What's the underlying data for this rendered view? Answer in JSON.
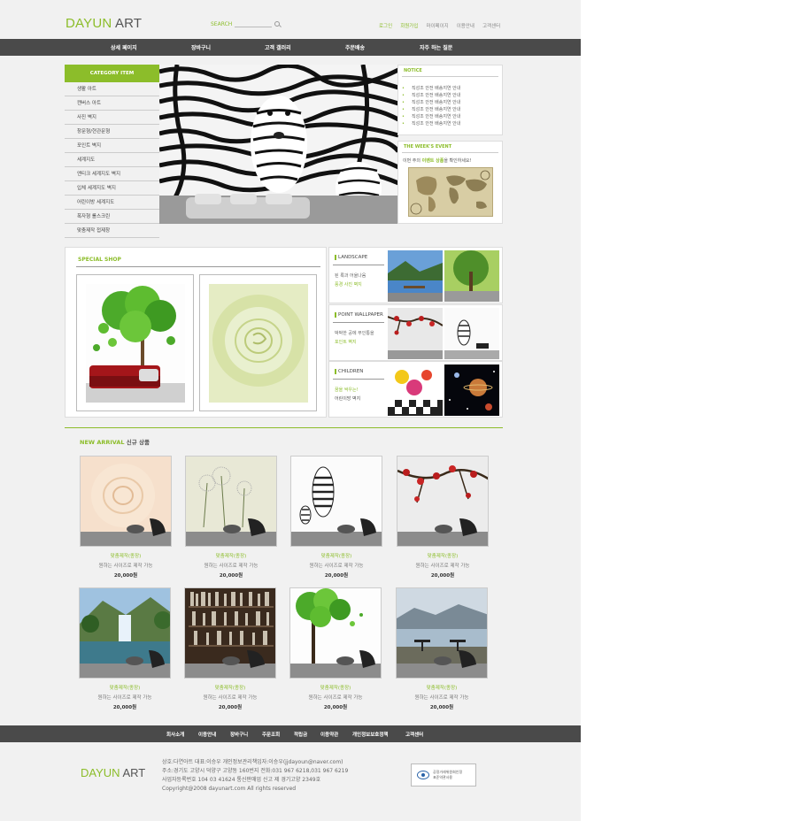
{
  "header": {
    "logo_green": "DAYUN",
    "logo_dark": " ART",
    "search_label": "SEARCH",
    "links": [
      "로그인",
      "회원가입",
      "마이페이지",
      "이용안내",
      "고객센터"
    ]
  },
  "gnb": [
    "상세 페이지",
    "장바구니",
    "고객 갤러리",
    "주문배송",
    "자주 하는 질문"
  ],
  "category": {
    "title": "CATEGORY ITEM",
    "items": [
      "생활 아트",
      "캔버스 아트",
      "사진 벽지",
      "창문형/현관문형",
      "포인트 벽지",
      "세계지도",
      "앤티크 세계지도 벽지",
      "입체 세계지도 벽지",
      "어린이방 세계지도",
      "폭자형 롤스크린",
      "맞춤제작 접제창"
    ]
  },
  "notice": {
    "title": "NOTICE",
    "items": [
      "직성조 안전 배송지연 안내",
      "직성조 안전 배송지연 안내",
      "직성조 안전 배송지연 안내",
      "직성조 안전 배송지연 안내",
      "직성조 안전 배송지연 안내",
      "직성조 안전 배송지연 안내"
    ]
  },
  "event": {
    "title": "THE WEEK'S EVENT",
    "text_pre": "이번 주의 ",
    "text_hl": "이벤트 상품",
    "text_post": "을 확인하세요!"
  },
  "special": {
    "title": "SPECIAL SHOP"
  },
  "themes": [
    {
      "name": "LANDSCAPE",
      "sub1": "된 록과 어울나움",
      "sub2": "풍경 사진 벽지"
    },
    {
      "name": "POINT WALLPAPER",
      "sub1": "박박한 공에 부인통을",
      "sub2": "포인트 벽지"
    },
    {
      "name": "CHILDREN",
      "sub1": "꿈을 싹우는!",
      "sub2": "어린이방 벽지"
    }
  ],
  "new_arrival": {
    "title_en": "NEW ARRIVAL",
    "title_ko": " 신규 상품"
  },
  "products": [
    {
      "name": "맞춤제작(종장)",
      "desc": "원하는 사이즈로 제작 가능",
      "price": "20,000원"
    },
    {
      "name": "맞춤제작(종장)",
      "desc": "원하는 사이즈로 제작 가능",
      "price": "20,000원"
    },
    {
      "name": "맞춤제작(종장)",
      "desc": "원하는 사이즈로 제작 가능",
      "price": "20,000원"
    },
    {
      "name": "맞춤제작(종장)",
      "desc": "원하는 사이즈로 제작 가능",
      "price": "20,000원"
    },
    {
      "name": "맞춤제작(종장)",
      "desc": "원하는 사이즈로 제작 가능",
      "price": "20,000원"
    },
    {
      "name": "맞춤제작(종장)",
      "desc": "원하는 사이즈로 제작 가능",
      "price": "20,000원"
    },
    {
      "name": "맞춤제작(종장)",
      "desc": "원하는 사이즈로 제작 가능",
      "price": "20,000원"
    },
    {
      "name": "맞춤제작(종장)",
      "desc": "원하는 사이즈로 제작 가능",
      "price": "20,000원"
    }
  ],
  "footer": {
    "links": [
      "회사소개",
      "이용안내",
      "장바구니",
      "주문조회",
      "적립금",
      "이용약관",
      "개인정보보호정책",
      "고객센터"
    ],
    "logo_green": "DAYUN",
    "logo_dark": " ART",
    "info_1": "상호:다연아트  대표:이승우  개인정보관리책임자:이승우(jjdayoun@naver.com)",
    "info_2": "주소:경기도 고양시 덕양구 고양동 160번지 전화:031 967 6218,031 967 6219",
    "info_3": "사업자등록번호 104 03 41624 통신판매업 신고 제 경기고양 2349호",
    "copyright": "Copyright@2008 dayunart.com All rights reserved",
    "badge_1": "공정거래위원회인정",
    "badge_2": "표준약관사용"
  },
  "colors": {
    "accent": "#8cbd2a",
    "nav_bg": "#4a4a4a",
    "page_bg": "#f1f1f1"
  }
}
